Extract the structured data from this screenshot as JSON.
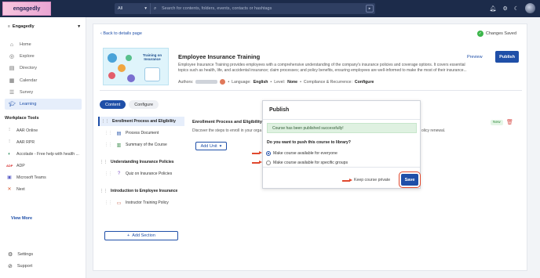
{
  "topbar": {
    "logo_text": "engagedly",
    "search_scope": "All",
    "search_placeholder": "Search for contents, folders, events, contacts or hashtags",
    "icons": [
      "bell-icon",
      "settings-icon",
      "moon-icon",
      "avatar"
    ]
  },
  "sidebar": {
    "org_name": "Engagedly",
    "items": [
      {
        "label": "Home",
        "icon": "home-icon"
      },
      {
        "label": "Explore",
        "icon": "explore-icon"
      },
      {
        "label": "Directory",
        "icon": "directory-icon"
      },
      {
        "label": "Calendar",
        "icon": "calendar-icon"
      },
      {
        "label": "Survey",
        "icon": "survey-icon"
      },
      {
        "label": "Learning",
        "icon": "learning-icon",
        "active": true
      }
    ],
    "workplace_tools_title": "Workplace Tools",
    "tools": [
      {
        "label": "AAR Online"
      },
      {
        "label": "AAR RPR"
      },
      {
        "label": "Accolade - Free help with health ..."
      },
      {
        "label": "ADP"
      },
      {
        "label": "Microsoft Teams"
      },
      {
        "label": "Next"
      }
    ],
    "view_more": "View More",
    "settings_label": "Settings",
    "support_label": "Support"
  },
  "main": {
    "back_link": "Back to details page",
    "changes_saved": "Changes Saved",
    "course": {
      "title": "Employee Insurance Training",
      "thumb_title": "Training on Insurance",
      "description": "Employee Insurance Training provides employees with a comprehensive understanding of the company's insurance policies and coverage options. It covers essential topics such as health, life, and accidental insurance; claim processes; and policy benefits, ensuring employees are well-informed to make the most of their insurance...",
      "authors_label": "Authors:",
      "language_label": "Language:",
      "language_value": "English",
      "level_label": "Level:",
      "level_value": "None",
      "compliance_label": "Compliance & Recurrence:",
      "compliance_value": "Configure",
      "preview_label": "Preview",
      "publish_label": "Publish"
    },
    "tabs": [
      "Content",
      "Configure"
    ],
    "outline": {
      "sections": [
        {
          "title": "Enrollment Process and Eligibility",
          "lessons": [
            "Process Document",
            "Summary of the Course"
          ]
        },
        {
          "title": "Understanding Insurance Policies",
          "lessons": [
            "Quiz on Insurance Policies"
          ]
        },
        {
          "title": "Introduction to Employee Insurance",
          "lessons": [
            "Instructor Training Policy"
          ]
        }
      ],
      "add_section_label": "Add Section"
    },
    "detail": {
      "title": "Enrollment Process and Eligibility",
      "description": "Discover the steps to enroll in your orga",
      "description_tail": "olicy renewal.",
      "badge": "New",
      "add_unit_label": "Add Unit"
    }
  },
  "modal": {
    "title": "Publish",
    "success_message": "Course has been published successfully!",
    "question": "Do you want to push this course to library?",
    "options": [
      {
        "label": "Make course available for everyone",
        "selected": true
      },
      {
        "label": "Make course available for specific groups",
        "selected": false
      }
    ],
    "keep_private_label": "Keep course private",
    "save_label": "Save"
  }
}
